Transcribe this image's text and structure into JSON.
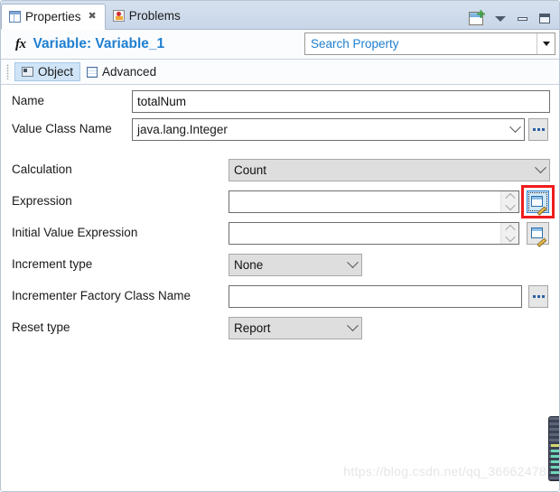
{
  "view_tabs": [
    {
      "label": "Properties",
      "icon": "table-icon",
      "active": true,
      "closable": true
    },
    {
      "label": "Problems",
      "icon": "problems-icon",
      "active": false,
      "closable": false
    }
  ],
  "toolbar": {
    "new_property_title": "new-property-icon",
    "view_menu_title": "view-menu-icon",
    "minimize_title": "minimize-icon",
    "maximize_title": "maximize-icon"
  },
  "header": {
    "fx_label": "fx",
    "title": "Variable: Variable_1"
  },
  "search": {
    "value": "",
    "placeholder": "Search Property"
  },
  "sub_tabs": [
    {
      "label": "Object",
      "icon": "object-icon",
      "active": true
    },
    {
      "label": "Advanced",
      "icon": "advanced-icon",
      "active": false
    }
  ],
  "form": {
    "name": {
      "label": "Name",
      "value": "totalNum"
    },
    "value_class_name": {
      "label": "Value Class Name",
      "value": "java.lang.Integer",
      "browse_label": "..."
    },
    "calculation": {
      "label": "Calculation",
      "value": "Count"
    },
    "expression": {
      "label": "Expression",
      "value": "",
      "edit_button": "edit-expression-button"
    },
    "initial_value_expression": {
      "label": "Initial Value Expression",
      "value": "",
      "edit_button": "edit-initial-value-expression-button"
    },
    "increment_type": {
      "label": "Increment type",
      "value": "None"
    },
    "incrementer_factory_class_name": {
      "label": "Incrementer Factory Class Name",
      "value": "",
      "browse_label": "..."
    },
    "reset_type": {
      "label": "Reset type",
      "value": "Report"
    }
  },
  "highlight": {
    "color": "#ef1c1c",
    "target": "expression-edit-button"
  },
  "watermark": "https://blog.csdn.net/qq_36662478"
}
